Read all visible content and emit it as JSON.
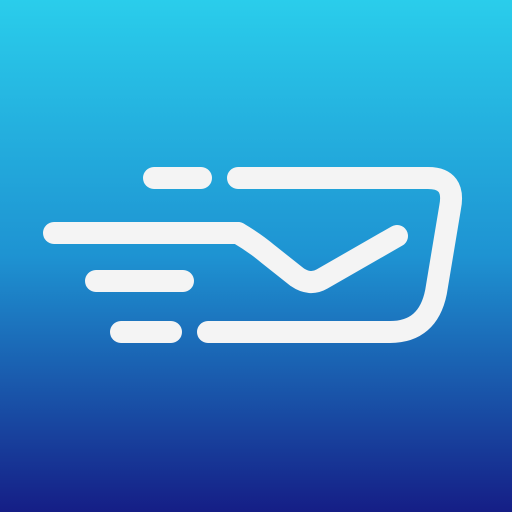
{
  "icon": {
    "semantic_name": "fast-mail-icon",
    "colors": {
      "gradient_top": "#2ACDEB",
      "gradient_middle": "#1E93D2",
      "gradient_bottom": "#151E86",
      "glyph": "#F4F4F4"
    }
  }
}
